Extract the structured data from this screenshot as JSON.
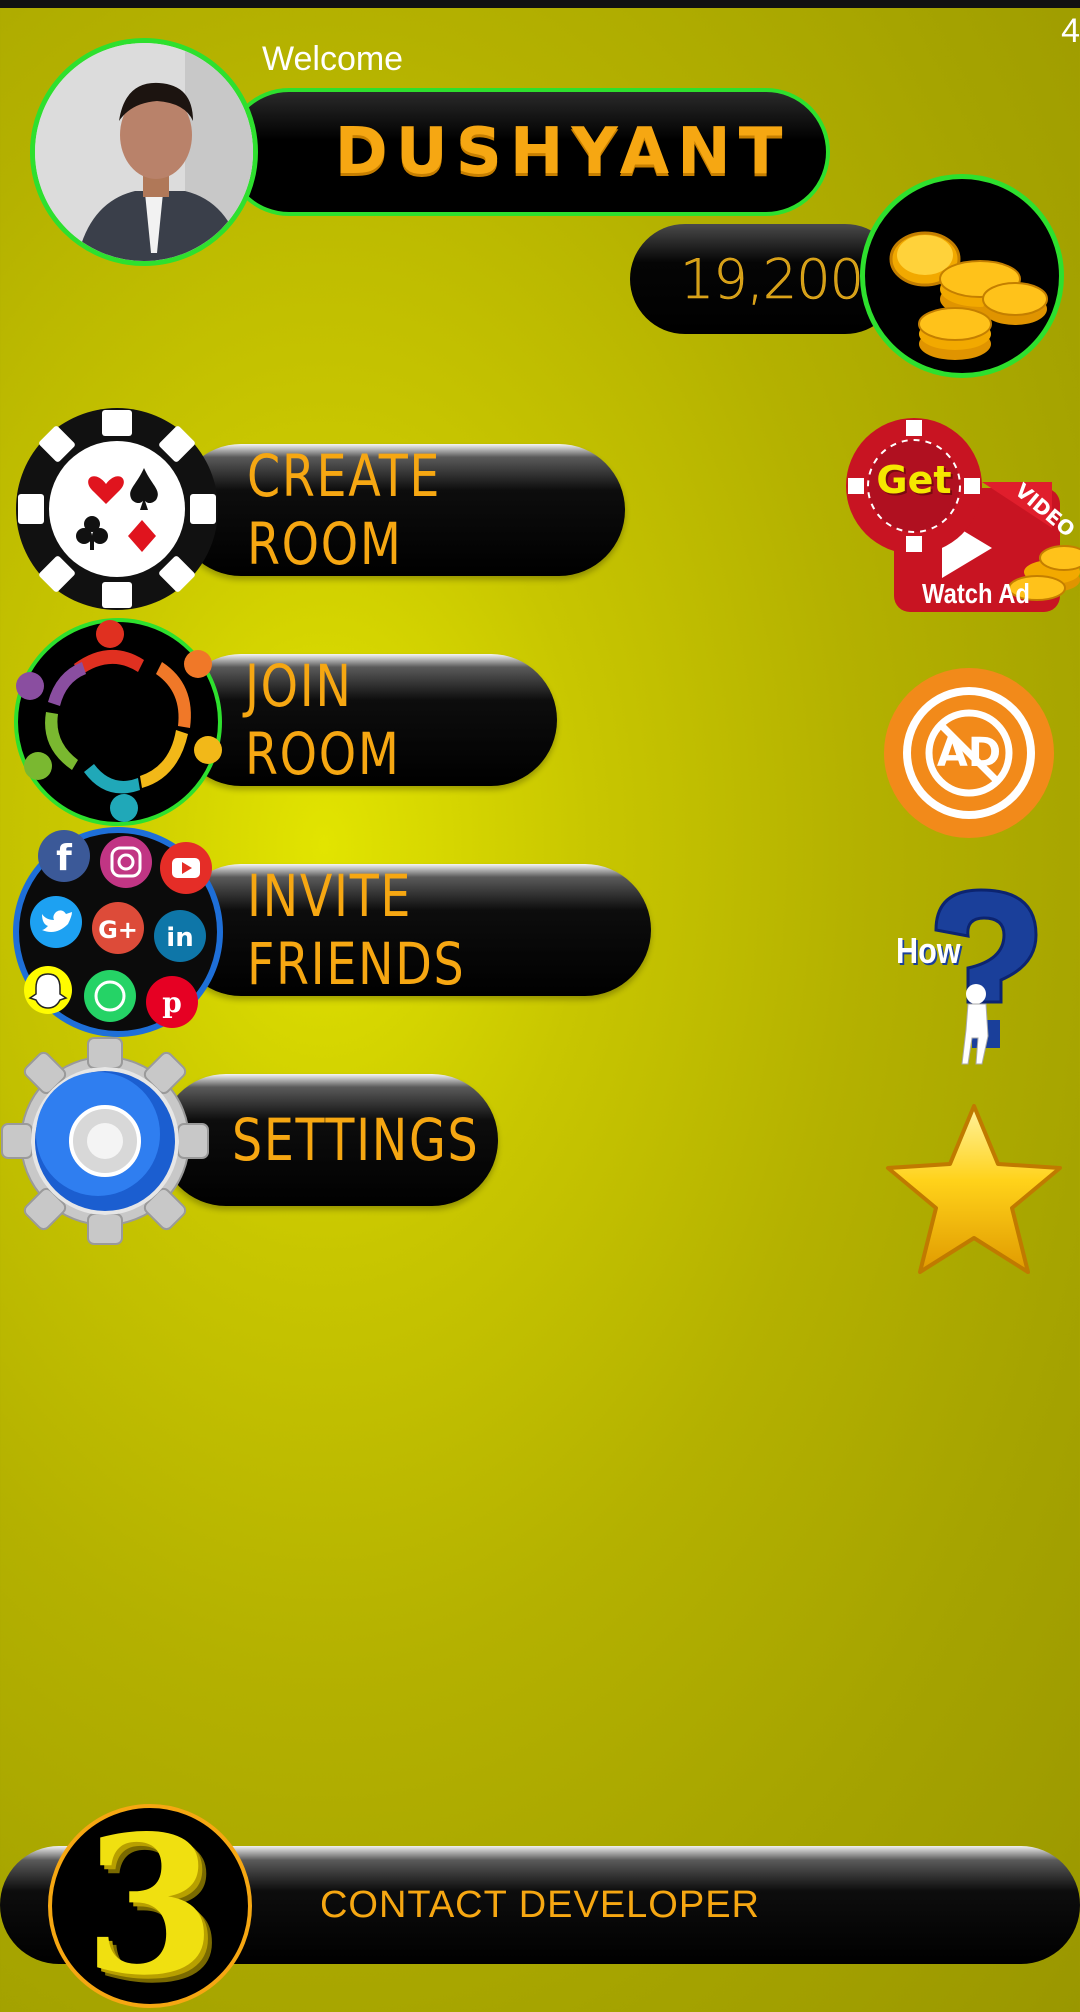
{
  "status_bar": {
    "right_text": "4"
  },
  "profile": {
    "welcome": "Welcome",
    "name": "DUSHYANT",
    "coins": "19,200",
    "coins_icon": "gold-coins-icon"
  },
  "menu": [
    {
      "label": "CREATE ROOM",
      "icon": "poker-chip-icon"
    },
    {
      "label": "JOIN ROOM",
      "icon": "people-circle-icon"
    },
    {
      "label": "INVITE FRIENDS",
      "icon": "social-media-icon"
    },
    {
      "label": "SETTINGS",
      "icon": "gear-icon"
    }
  ],
  "side": {
    "watch_ad": {
      "get": "Get",
      "video": "VIDEO",
      "watch": "Watch Ad"
    },
    "no_ad": {
      "text": "AD"
    },
    "how": {
      "text": "How"
    },
    "rate": {
      "icon": "star-icon"
    }
  },
  "bottom": {
    "contact_label": "CONTACT DEVELOPER",
    "logo_text": "3"
  },
  "colors": {
    "accent": "#f6a712",
    "green_border": "#2ee02e",
    "background": "#c8c600"
  }
}
